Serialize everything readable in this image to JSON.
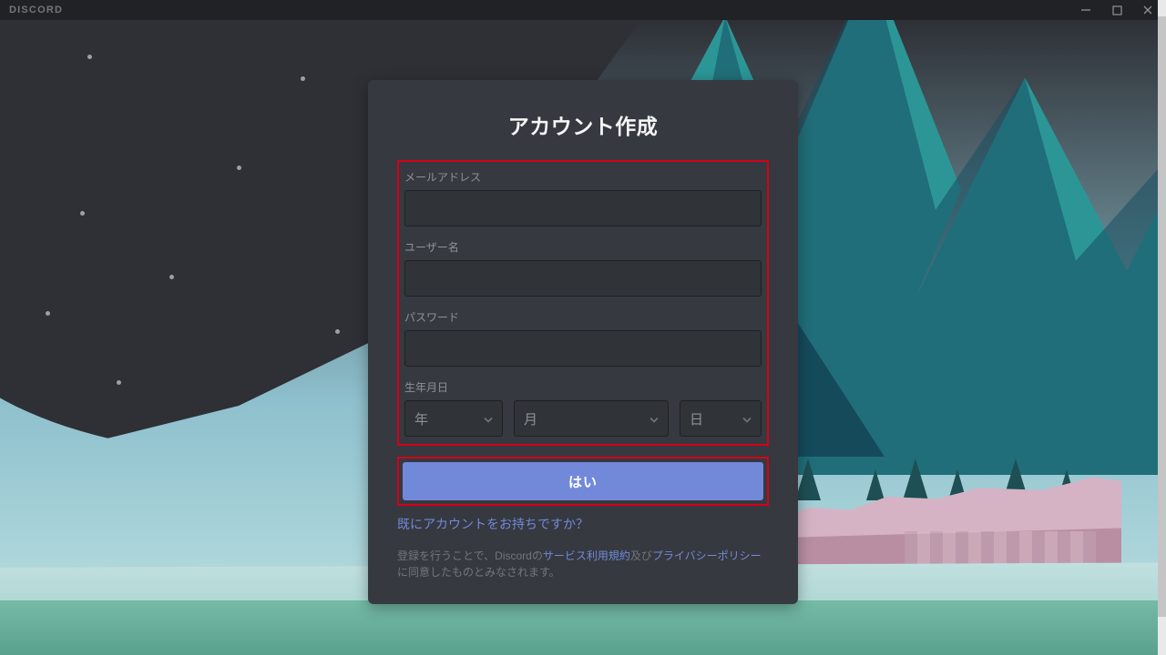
{
  "app": {
    "logo": "DISCORD"
  },
  "window_controls": {
    "minimize": "minimize",
    "maximize": "maximize",
    "close": "close"
  },
  "card": {
    "title": "アカウント作成",
    "email_label": "メールアドレス",
    "username_label": "ユーザー名",
    "password_label": "パスワード",
    "dob_label": "生年月日",
    "dob": {
      "year": "年",
      "month": "月",
      "day": "日"
    },
    "submit": "はい",
    "already": "既にアカウントをお持ちですか？",
    "terms_pre": "登録を行うことで、Discordの",
    "terms_tos": "サービス利用規約",
    "terms_mid": "及び",
    "terms_privacy": "プライバシーポリシー",
    "terms_post": "に同意したものとみなされます。"
  }
}
